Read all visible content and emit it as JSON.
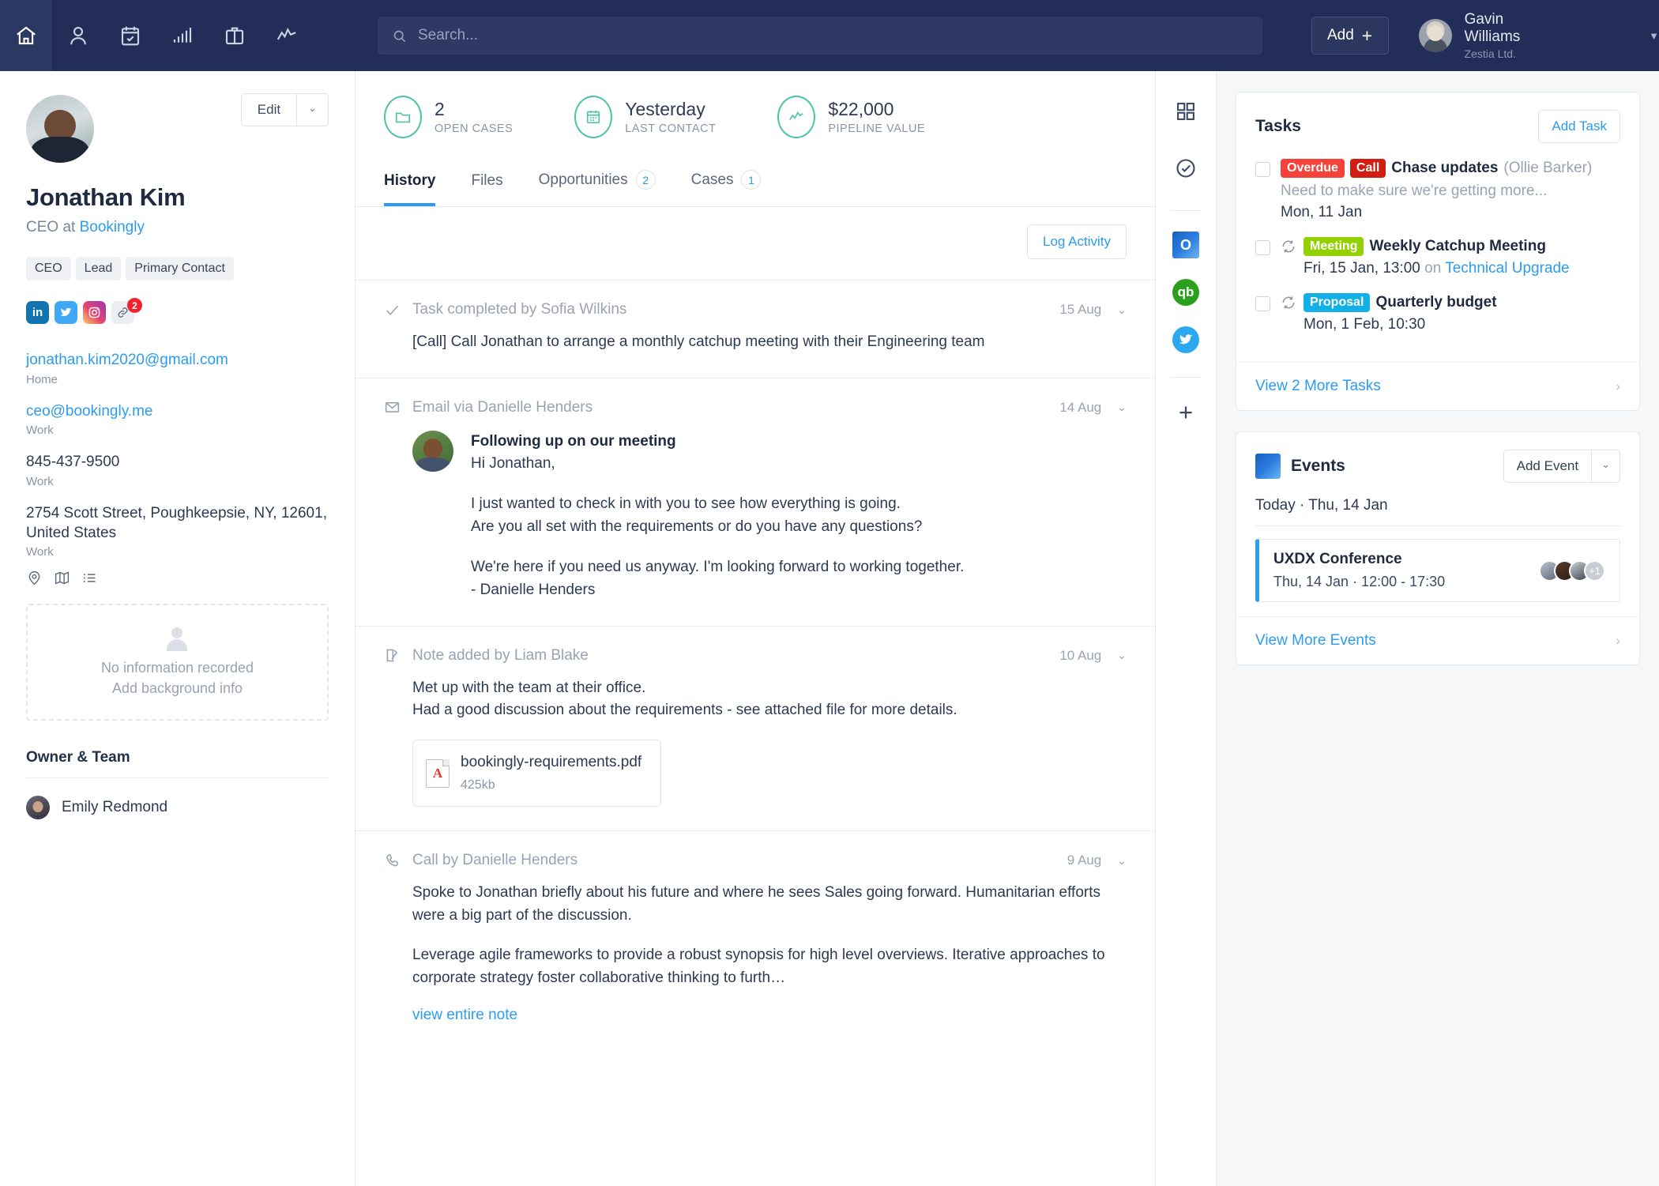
{
  "topnav": {
    "icons": [
      "home-icon",
      "contacts-icon",
      "calendar-tasks-icon",
      "reports-icon",
      "opportunities-icon",
      "activity-icon"
    ],
    "search_placeholder": "Search...",
    "add_label": "Add",
    "add_plus": "+",
    "user_name": "Gavin Williams",
    "user_org": "Zestia Ltd."
  },
  "contact": {
    "edit_label": "Edit",
    "name": "Jonathan Kim",
    "role_prefix": "CEO at ",
    "company": "Bookingly",
    "tags": [
      "CEO",
      "Lead",
      "Primary Contact"
    ],
    "social_badge": "2",
    "fields": [
      {
        "value": "jonathan.kim2020@gmail.com",
        "label": "Home",
        "link": true
      },
      {
        "value": "ceo@bookingly.me",
        "label": "Work",
        "link": true
      },
      {
        "value": "845-437-9500",
        "label": "Work",
        "link": false
      },
      {
        "value": "2754 Scott Street, Poughkeepsie, NY, 12601, United States",
        "label": "Work",
        "link": false
      }
    ],
    "background_empty_1": "No information recorded",
    "background_empty_2": "Add background info",
    "owner_header": "Owner & Team",
    "owner_name": "Emily Redmond"
  },
  "stats": [
    {
      "icon": "folder-icon",
      "value": "2",
      "caption": "OPEN CASES"
    },
    {
      "icon": "calendar-icon",
      "value": "Yesterday",
      "caption": "LAST CONTACT"
    },
    {
      "icon": "trend-icon",
      "value": "$22,000",
      "caption": "PIPELINE VALUE"
    }
  ],
  "tabs": [
    {
      "label": "History",
      "count": null,
      "active": true
    },
    {
      "label": "Files",
      "count": null,
      "active": false
    },
    {
      "label": "Opportunities",
      "count": "2",
      "active": false
    },
    {
      "label": "Cases",
      "count": "1",
      "active": false
    }
  ],
  "log_activity_label": "Log Activity",
  "timeline": [
    {
      "icon": "check-icon",
      "title": "Task completed by Sofia Wilkins",
      "date": "15 Aug",
      "body": "[Call] Call Jonathan to arrange a monthly catchup meeting with their Engineering team"
    },
    {
      "icon": "envelope-icon",
      "title": "Email via Danielle Henders",
      "date": "14 Aug",
      "subject": "Following up on our meeting",
      "greeting": "Hi Jonathan,",
      "para1_line1": "I just wanted to check in with you to see how everything is going.",
      "para1_line2": "Are you all set with the requirements or do you have any questions?",
      "para2_line1": "We're here if you need us anyway. I'm looking forward to working together.",
      "para2_line2": "- Danielle Henders"
    },
    {
      "icon": "note-icon",
      "title": "Note added by Liam Blake",
      "date": "10 Aug",
      "body_line1": "Met up with the team at their office.",
      "body_line2": "Had a good discussion about the requirements - see attached file for more details.",
      "attachment_name": "bookingly-requirements.pdf",
      "attachment_size": "425kb"
    },
    {
      "icon": "phone-icon",
      "title": "Call by Danielle Henders",
      "date": "9 Aug",
      "para1": "Spoke to Jonathan briefly about his future and where he sees Sales going forward. Humanitarian efforts were a big part of the discussion.",
      "para2": "Leverage agile frameworks to provide a robust synopsis for high level overviews. Iterative approaches to corporate strategy foster collaborative thinking to furth…",
      "view_link": "view entire note"
    }
  ],
  "rail": {
    "items": [
      "apps-grid-icon",
      "tasks-check-icon"
    ],
    "apps": [
      {
        "name": "outlook-icon",
        "glyph": "O"
      },
      {
        "name": "quickbooks-icon",
        "glyph": "qb"
      },
      {
        "name": "twitter-icon",
        "glyph": ""
      }
    ],
    "add_glyph": "+"
  },
  "tasks_panel": {
    "title": "Tasks",
    "add_label": "Add Task",
    "items": [
      {
        "pills": [
          {
            "text": "Overdue",
            "kind": "overdue"
          },
          {
            "text": "Call",
            "kind": "call"
          }
        ],
        "recurring": false,
        "name": "Chase updates",
        "owner": "(Ollie Barker)",
        "desc": "Need to make sure we're getting more...",
        "when": "Mon, 11 Jan",
        "when_on": "",
        "when_link": ""
      },
      {
        "pills": [
          {
            "text": "Meeting",
            "kind": "meeting"
          }
        ],
        "recurring": true,
        "name": "Weekly Catchup Meeting",
        "owner": "",
        "desc": "",
        "when": "Fri, 15 Jan, 13:00",
        "when_on": " on ",
        "when_link": "Technical Upgrade"
      },
      {
        "pills": [
          {
            "text": "Proposal",
            "kind": "proposal"
          }
        ],
        "recurring": true,
        "name": "Quarterly budget",
        "owner": "",
        "desc": "",
        "when": "Mon, 1 Feb, 10:30",
        "when_on": "",
        "when_link": ""
      }
    ],
    "footer_link": "View 2 More Tasks"
  },
  "events_panel": {
    "title": "Events",
    "add_label": "Add Event",
    "today_label": "Today · Thu, 14 Jan",
    "event_name": "UXDX Conference",
    "event_time": "Thu, 14 Jan · 12:00 - 17:30",
    "attendee_overflow": "+1",
    "footer_link": "View More Events"
  },
  "colors": {
    "navy": "#222e57",
    "accent_blue": "#2b9cf0",
    "teal": "#4ec2a8",
    "overdue_red": "#f5433c",
    "call_red": "#d01f12",
    "meeting_green": "#92d000",
    "proposal_cyan": "#11b0e6"
  }
}
